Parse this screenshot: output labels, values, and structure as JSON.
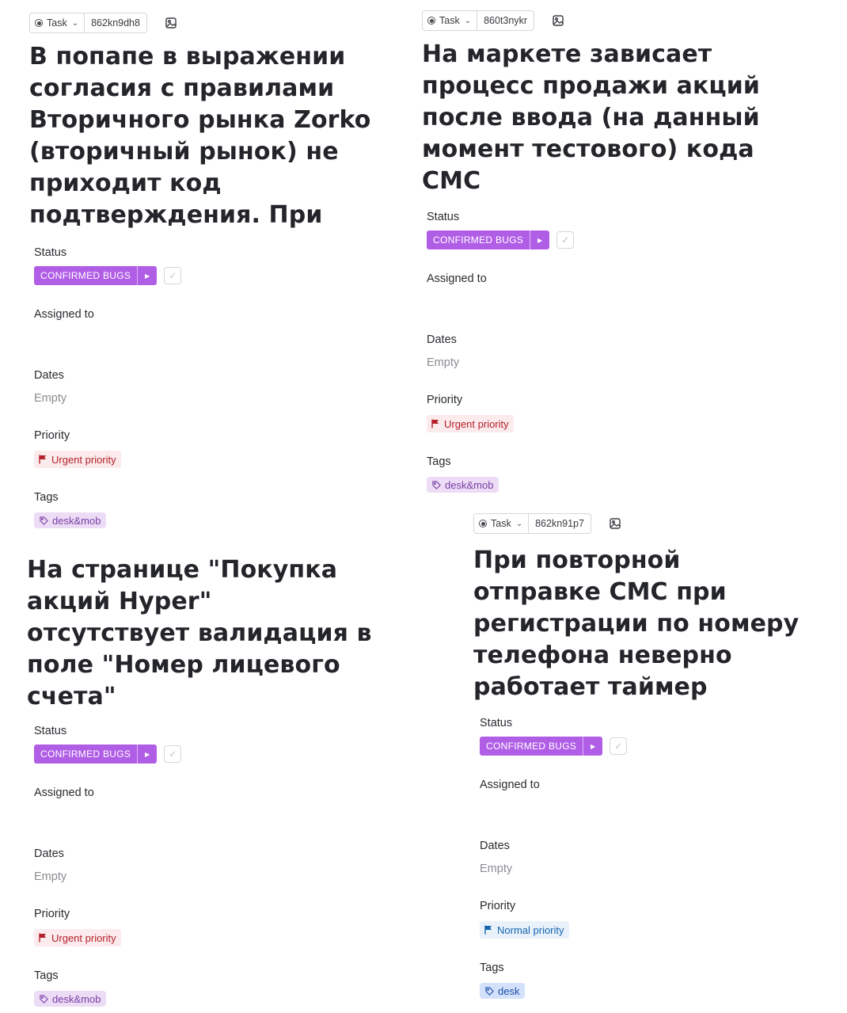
{
  "cards": [
    {
      "type_label": "Task",
      "task_id": "862kn9dh8",
      "title": "В попапе в выражении согласия с правилами Вторичного рынка Zorko (вторичный рынок) не приходит код подтверждения. При",
      "status_label": "Status",
      "status_value": "CONFIRMED BUGS",
      "assigned_label": "Assigned to",
      "dates_label": "Dates",
      "dates_value": "Empty",
      "priority_label": "Priority",
      "priority_value": "Urgent priority",
      "tags_label": "Tags",
      "tag_value": "desk&mob"
    },
    {
      "type_label": "Task",
      "task_id": "860t3nykr",
      "title": "На маркете зависает процесс продажи акций после ввода (на данный момент тестового) кода СМС",
      "status_label": "Status",
      "status_value": "CONFIRMED BUGS",
      "assigned_label": "Assigned to",
      "dates_label": "Dates",
      "dates_value": "Empty",
      "priority_label": "Priority",
      "priority_value": "Urgent priority",
      "tags_label": "Tags",
      "tag_value": "desk&mob"
    },
    {
      "title": "На странице \"Покупка акций Hyper\" отсутствует валидация в поле \"Номер лицевого счета\"",
      "status_label": "Status",
      "status_value": "CONFIRMED BUGS",
      "assigned_label": "Assigned to",
      "dates_label": "Dates",
      "dates_value": "Empty",
      "priority_label": "Priority",
      "priority_value": "Urgent priority",
      "tags_label": "Tags",
      "tag_value": "desk&mob"
    },
    {
      "type_label": "Task",
      "task_id": "862kn91p7",
      "title": "При повторной отправке СМС при регистрации по номеру телефона неверно работает таймер",
      "status_label": "Status",
      "status_value": "CONFIRMED BUGS",
      "assigned_label": "Assigned to",
      "dates_label": "Dates",
      "dates_value": "Empty",
      "priority_label": "Priority",
      "priority_value": "Normal priority",
      "tags_label": "Tags",
      "tag_value": "desk"
    }
  ],
  "colors": {
    "status_purple": "#b15ee6",
    "urgent_red": "#b3202b",
    "normal_blue": "#1565b0",
    "tag_purple_bg": "#ecdcf5",
    "tag_blue_bg": "#d3e1fb"
  },
  "icons": {
    "type": "radio-dot-icon",
    "dropdown": "chevron-down-icon",
    "cover_image": "image-icon",
    "status_next": "triangle-right-icon",
    "complete": "checkmark-icon",
    "priority": "flag-icon",
    "tag": "tag-icon"
  }
}
